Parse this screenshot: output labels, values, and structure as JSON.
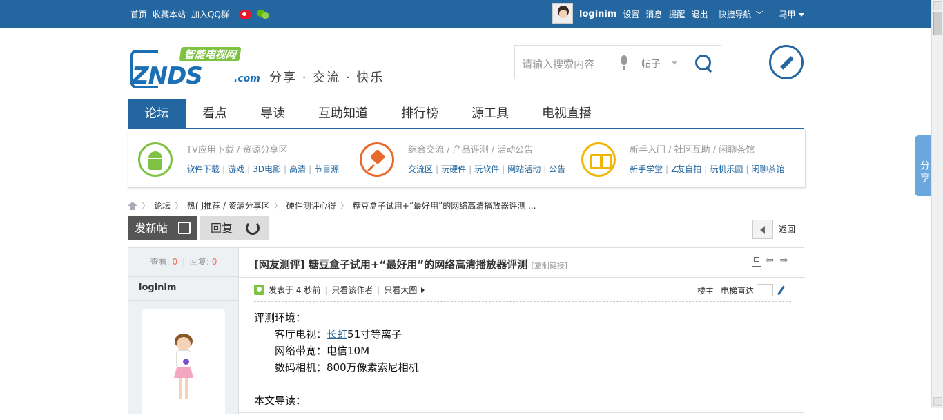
{
  "topbar": {
    "links": [
      "首页",
      "收藏本站",
      "加入QQ群"
    ],
    "username": "loginim",
    "user_links": [
      "设置",
      "消息",
      "提醒",
      "退出"
    ],
    "quick_nav": "快捷导航",
    "extra": "马甲"
  },
  "logo": {
    "tag": "智能电视网",
    "main": "ZNDS",
    "com": ".com"
  },
  "slogan": "分享 · 交流 · 快乐",
  "search": {
    "placeholder": "请输入搜索内容",
    "type": "帖子"
  },
  "nav": [
    "论坛",
    "看点",
    "导读",
    "互助知道",
    "排行榜",
    "源工具",
    "电视直播"
  ],
  "subnav": [
    {
      "title": "TV应用下载 / 资源分享区",
      "links": [
        "软件下载",
        "游戏",
        "3D电影",
        "高清",
        "节目源"
      ],
      "icon": "android-icon"
    },
    {
      "title": "综合交流 / 产品评测 / 活动公告",
      "links": [
        "交流区",
        "玩硬件",
        "玩软件",
        "网站活动",
        "公告"
      ],
      "icon": "pin-icon"
    },
    {
      "title": "新手入门 / 社区互助 / 闲聊茶馆",
      "links": [
        "新手学堂",
        "Z友自拍",
        "玩机乐园",
        "闲聊茶馆"
      ],
      "icon": "book-icon"
    }
  ],
  "breadcrumb": [
    "论坛",
    "热门推荐 / 资源分享区",
    "硬件测评心得",
    "糖豆盒子试用+“最好用”的网络高清播放器评测 ..."
  ],
  "buttons": {
    "post": "发新帖",
    "reply": "回复",
    "back": "返回"
  },
  "share": "分享",
  "post": {
    "stats": {
      "view_label": "查看:",
      "views": "0",
      "reply_label": "回复:",
      "replies": "0"
    },
    "author": "loginim",
    "title": "[网友测评] 糖豆盒子试用+“最好用”的网络高清播放器评测",
    "copy_link": "[复制链接]",
    "meta": {
      "posted": "发表于 4 秒前",
      "only_author": "只看该作者",
      "big_image": "只看大图"
    },
    "floor": {
      "label": "楼主",
      "jump": "电梯直达"
    },
    "content": {
      "env_label": "评测环境：",
      "tv_pre": "客厅电视：",
      "tv_link": "长虹",
      "tv_post": "51寸等离子",
      "net": "网络带宽：电信10M",
      "cam_pre": "数码相机：800万像素",
      "cam_link": "索尼",
      "cam_post": "相机",
      "guide": "本文导读："
    }
  }
}
